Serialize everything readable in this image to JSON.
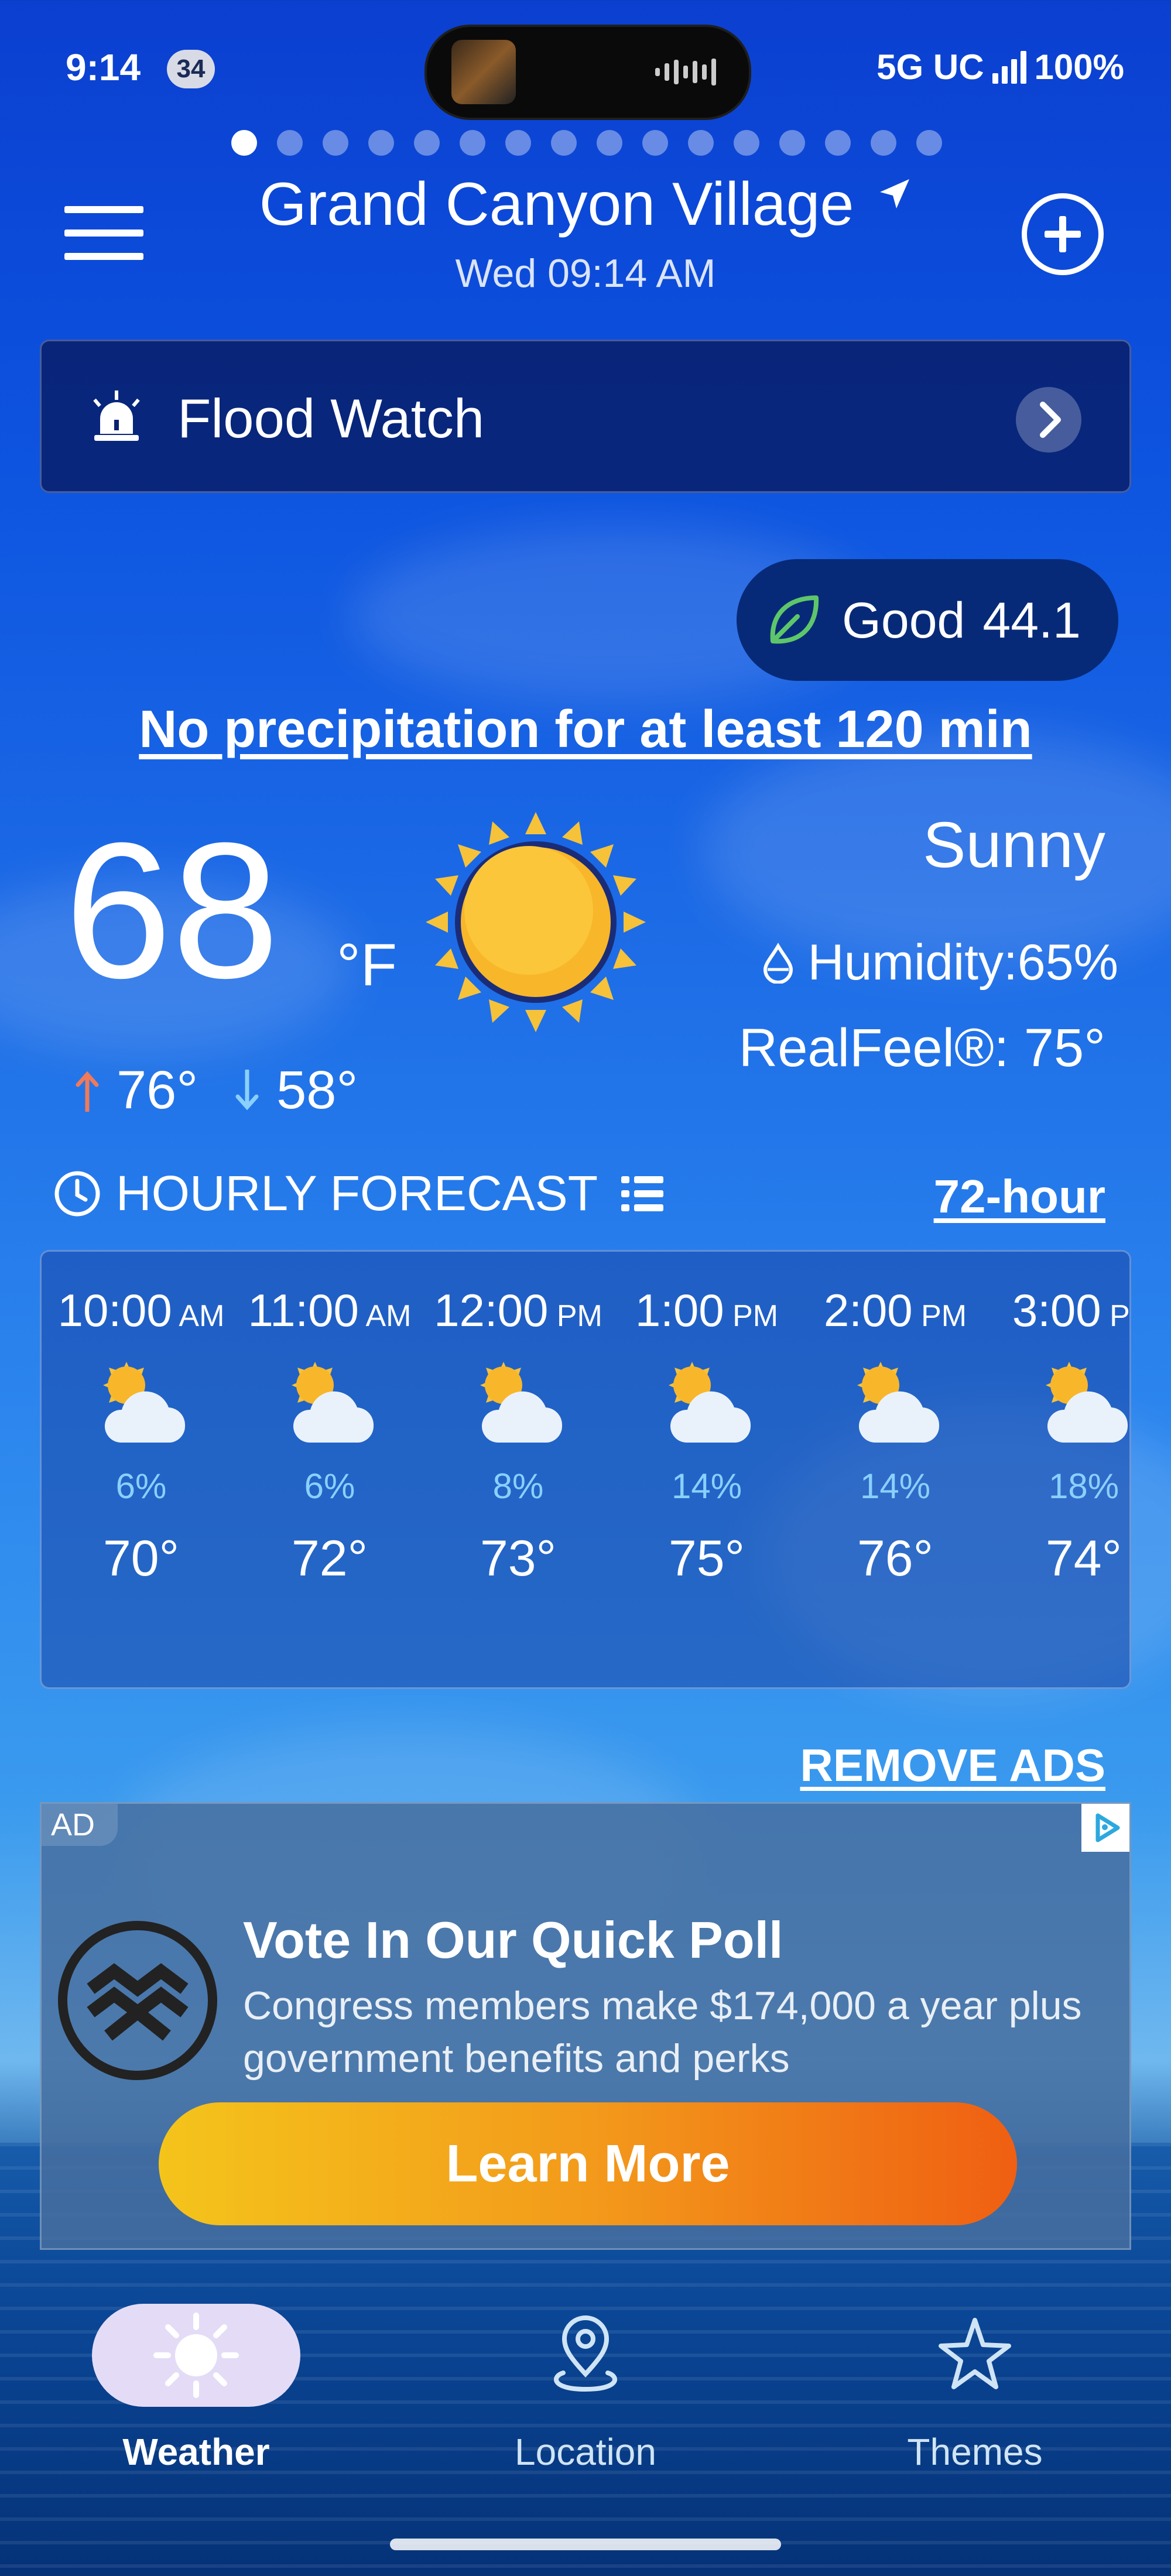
{
  "status_bar": {
    "time": "9:14",
    "notification_count": "34",
    "network": "5G UC",
    "battery": "100%"
  },
  "pager": {
    "total": 16,
    "active_index": 0
  },
  "header": {
    "city": "Grand Canyon Village",
    "datetime": "Wed 09:14 AM",
    "icons": {
      "menu": "menu-icon",
      "location": "location-arrow-icon",
      "add": "add-circle-icon"
    }
  },
  "alert": {
    "label": "Flood Watch",
    "icon": "siren-icon"
  },
  "air_quality": {
    "label": "Good",
    "value": "44.1",
    "icon": "leaf-icon"
  },
  "precipitation_note": "No precipitation for at least 120 min",
  "current": {
    "temperature": "68",
    "unit": "°F",
    "condition": "Sunny",
    "humidity": "Humidity:65%",
    "realfeel": "RealFeel®: 75°",
    "high": "76°",
    "low": "58°",
    "icon": "sun-icon"
  },
  "hourly": {
    "title": "HOURLY FORECAST",
    "link": "72-hour",
    "items": [
      {
        "time": "10:00",
        "ampm": "AM",
        "pop": "6%",
        "temp": "70°"
      },
      {
        "time": "11:00",
        "ampm": "AM",
        "pop": "6%",
        "temp": "72°"
      },
      {
        "time": "12:00",
        "ampm": "PM",
        "pop": "8%",
        "temp": "73°"
      },
      {
        "time": "1:00",
        "ampm": "PM",
        "pop": "14%",
        "temp": "75°"
      },
      {
        "time": "2:00",
        "ampm": "PM",
        "pop": "14%",
        "temp": "76°"
      },
      {
        "time": "3:00",
        "ampm": "PM",
        "pop": "18%",
        "temp": "74°"
      }
    ]
  },
  "remove_ads": "REMOVE ADS",
  "ad": {
    "tag": "AD",
    "title": "Vote In Our Quick Poll",
    "body": "Congress members make $174,000 a year plus government benefits and perks",
    "cta": "Learn More"
  },
  "nav": {
    "items": [
      {
        "label": "Weather",
        "icon": "sun-icon",
        "active": true
      },
      {
        "label": "Location",
        "icon": "location-pin-icon",
        "active": false
      },
      {
        "label": "Themes",
        "icon": "star-icon",
        "active": false
      }
    ]
  },
  "colors": {
    "accent_red": "#f07a5a",
    "accent_blue": "#8ad0ff",
    "aqi_green": "#5ec66a",
    "cta_start": "#f4c41b",
    "cta_end": "#ef5f12"
  }
}
